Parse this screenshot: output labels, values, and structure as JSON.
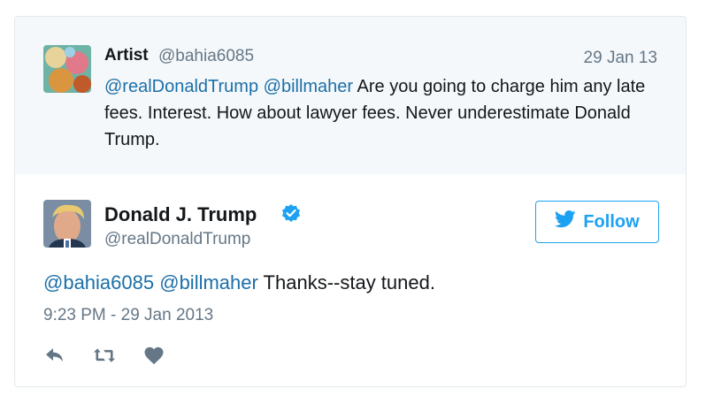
{
  "quoted_tweet": {
    "name": "Artist",
    "handle": "@bahia6085",
    "date": "29 Jan 13",
    "mentions": [
      "@realDonaldTrump",
      "@billmaher"
    ],
    "text": " Are you going to charge him any late fees. Interest. How about lawyer fees. Never underestimate Donald Trump."
  },
  "main_tweet": {
    "name": "Donald J. Trump",
    "handle": "@realDonaldTrump",
    "verified_icon": "verified-badge-icon",
    "follow_label": "Follow",
    "mentions": [
      "@bahia6085",
      "@billmaher"
    ],
    "text": " Thanks--stay tuned.",
    "timestamp": "9:23 PM - 29 Jan 2013"
  },
  "actions": {
    "reply_icon": "reply-icon",
    "retweet_icon": "retweet-icon",
    "like_icon": "heart-icon"
  },
  "colors": {
    "accent": "#1da1f2",
    "mention": "#1b6fa8",
    "muted": "#657786",
    "quoted_bg": "#f5f8fa",
    "border": "#e1e8ed"
  }
}
